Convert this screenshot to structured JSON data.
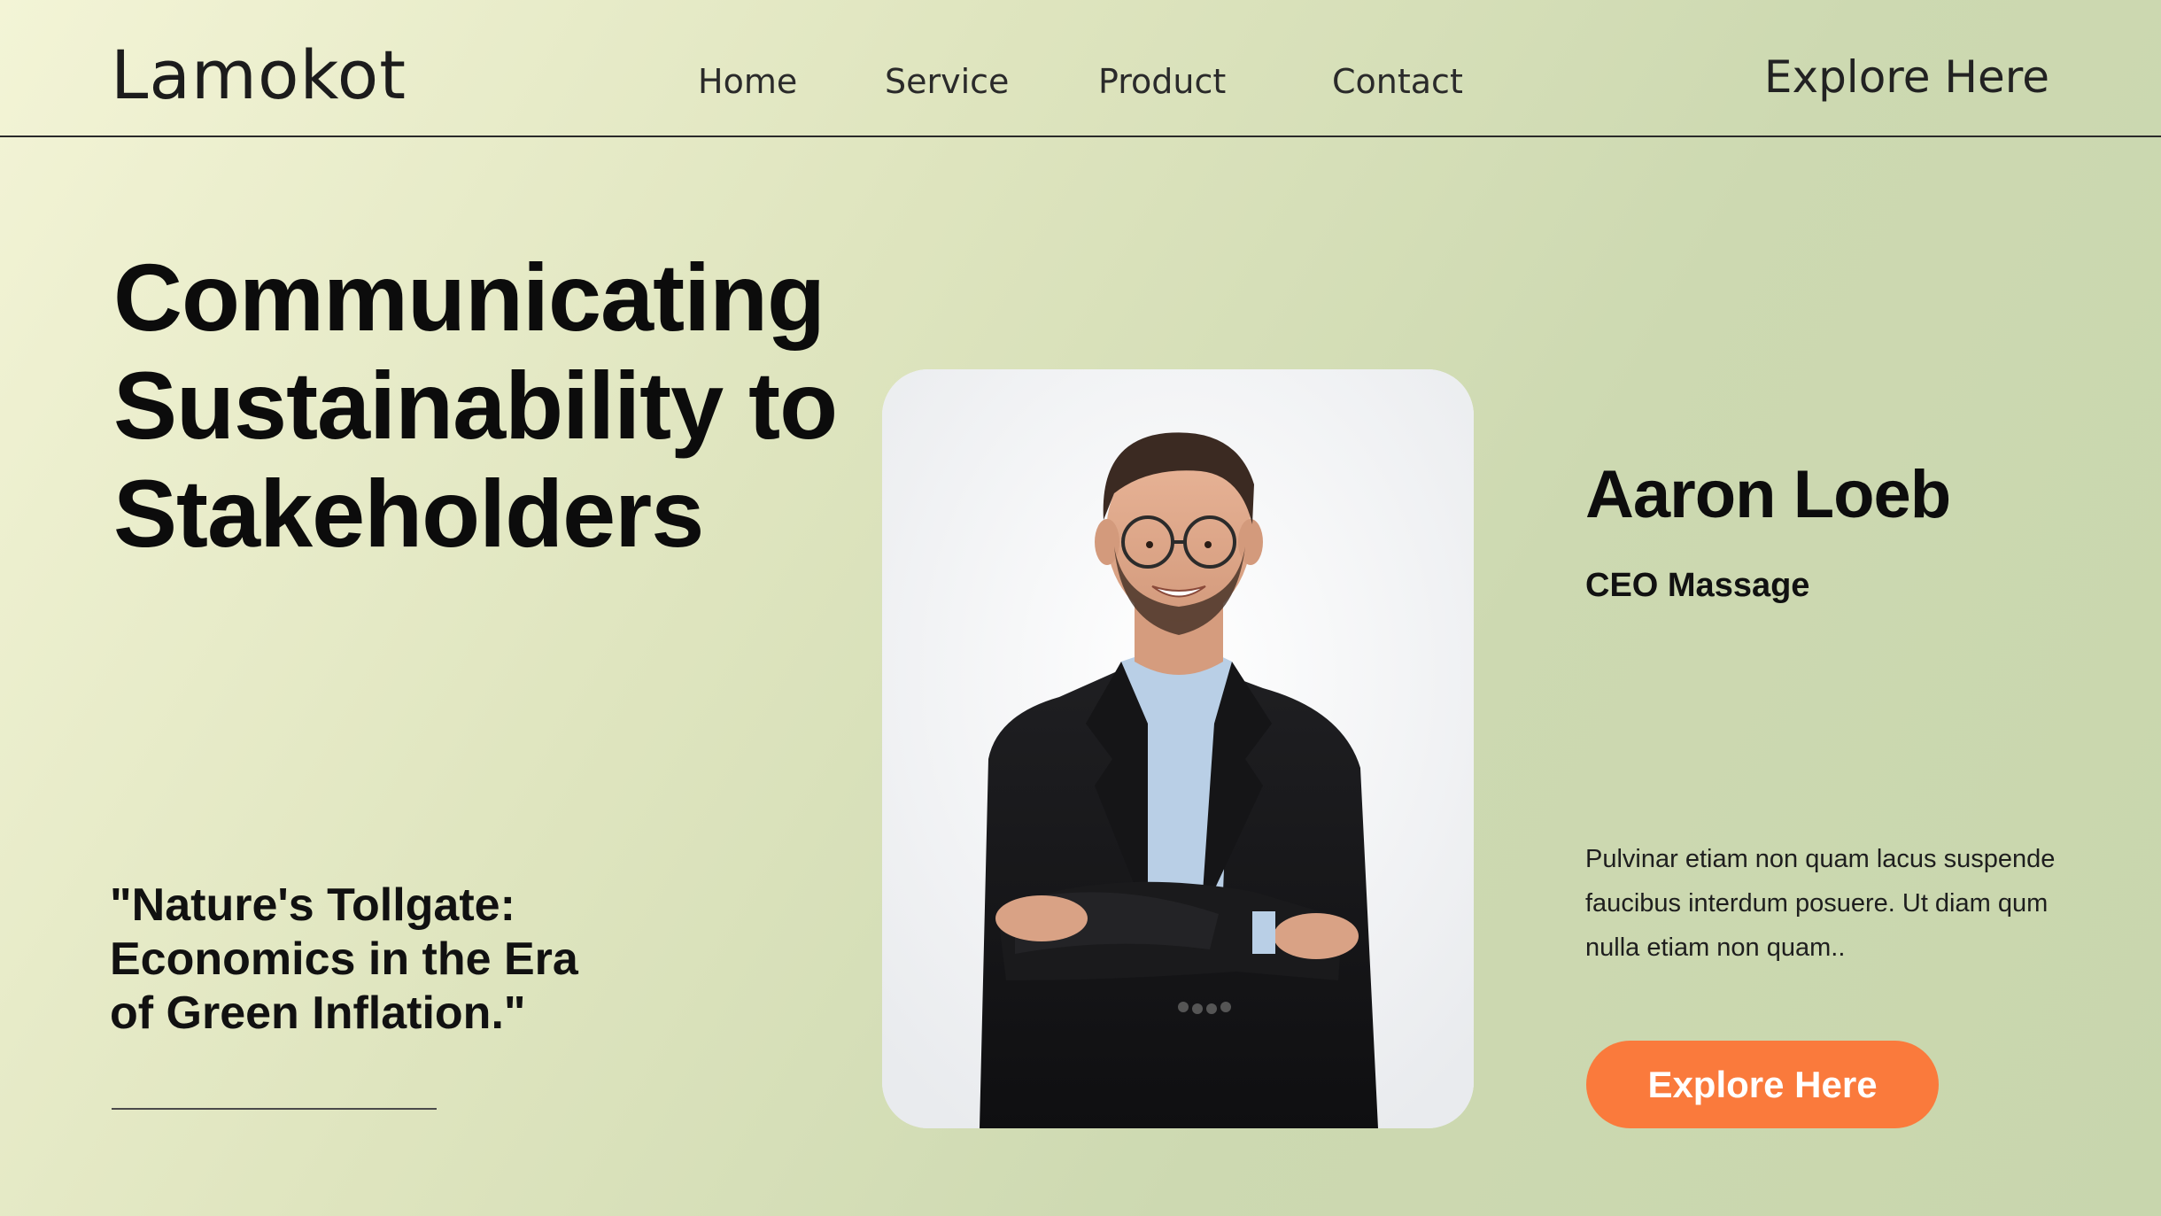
{
  "brand": {
    "logo_text": "Lamokot"
  },
  "nav": {
    "items": [
      {
        "label": "Home"
      },
      {
        "label": "Service"
      },
      {
        "label": "Product"
      },
      {
        "label": "Contact"
      }
    ],
    "cta_label": "Explore Here"
  },
  "hero": {
    "headline_lines": [
      "Communicating",
      "Sustainability to",
      "Stakeholders"
    ],
    "quote_lines": [
      "\"Nature's Tollgate:",
      "Economics in the Era",
      "of Green Inflation.\""
    ]
  },
  "profile": {
    "name": "Aaron Loeb",
    "role": "CEO Massage",
    "bio_lines": [
      "Pulvinar etiam non quam lacus suspende",
      "faucibus interdum posuere. Ut diam qum",
      "nulla etiam non quam.."
    ],
    "cta_label": "Explore Here"
  },
  "colors": {
    "accent": "#fa7a3c",
    "background_start": "#f3f4d6",
    "background_end": "#c8d6ad",
    "text": "#111111"
  }
}
